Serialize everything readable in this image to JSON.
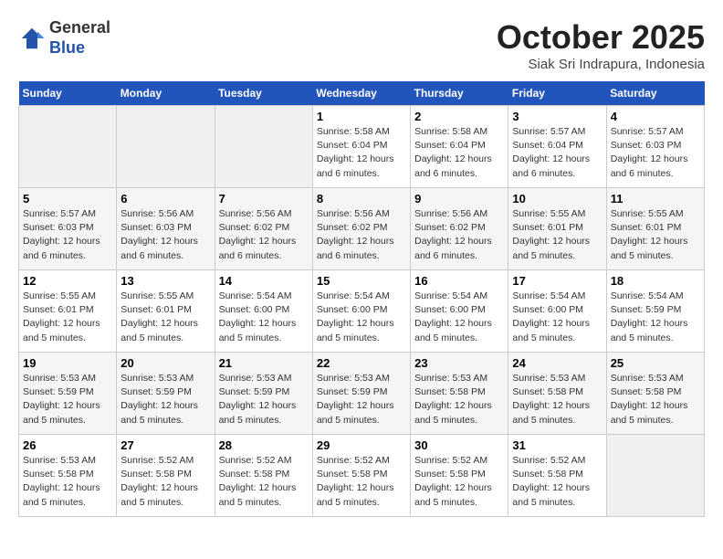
{
  "header": {
    "logo_line1": "General",
    "logo_line2": "Blue",
    "month": "October 2025",
    "location": "Siak Sri Indrapura, Indonesia"
  },
  "weekdays": [
    "Sunday",
    "Monday",
    "Tuesday",
    "Wednesday",
    "Thursday",
    "Friday",
    "Saturday"
  ],
  "weeks": [
    [
      {
        "day": "",
        "info": ""
      },
      {
        "day": "",
        "info": ""
      },
      {
        "day": "",
        "info": ""
      },
      {
        "day": "1",
        "info": "Sunrise: 5:58 AM\nSunset: 6:04 PM\nDaylight: 12 hours\nand 6 minutes."
      },
      {
        "day": "2",
        "info": "Sunrise: 5:58 AM\nSunset: 6:04 PM\nDaylight: 12 hours\nand 6 minutes."
      },
      {
        "day": "3",
        "info": "Sunrise: 5:57 AM\nSunset: 6:04 PM\nDaylight: 12 hours\nand 6 minutes."
      },
      {
        "day": "4",
        "info": "Sunrise: 5:57 AM\nSunset: 6:03 PM\nDaylight: 12 hours\nand 6 minutes."
      }
    ],
    [
      {
        "day": "5",
        "info": "Sunrise: 5:57 AM\nSunset: 6:03 PM\nDaylight: 12 hours\nand 6 minutes."
      },
      {
        "day": "6",
        "info": "Sunrise: 5:56 AM\nSunset: 6:03 PM\nDaylight: 12 hours\nand 6 minutes."
      },
      {
        "day": "7",
        "info": "Sunrise: 5:56 AM\nSunset: 6:02 PM\nDaylight: 12 hours\nand 6 minutes."
      },
      {
        "day": "8",
        "info": "Sunrise: 5:56 AM\nSunset: 6:02 PM\nDaylight: 12 hours\nand 6 minutes."
      },
      {
        "day": "9",
        "info": "Sunrise: 5:56 AM\nSunset: 6:02 PM\nDaylight: 12 hours\nand 6 minutes."
      },
      {
        "day": "10",
        "info": "Sunrise: 5:55 AM\nSunset: 6:01 PM\nDaylight: 12 hours\nand 5 minutes."
      },
      {
        "day": "11",
        "info": "Sunrise: 5:55 AM\nSunset: 6:01 PM\nDaylight: 12 hours\nand 5 minutes."
      }
    ],
    [
      {
        "day": "12",
        "info": "Sunrise: 5:55 AM\nSunset: 6:01 PM\nDaylight: 12 hours\nand 5 minutes."
      },
      {
        "day": "13",
        "info": "Sunrise: 5:55 AM\nSunset: 6:01 PM\nDaylight: 12 hours\nand 5 minutes."
      },
      {
        "day": "14",
        "info": "Sunrise: 5:54 AM\nSunset: 6:00 PM\nDaylight: 12 hours\nand 5 minutes."
      },
      {
        "day": "15",
        "info": "Sunrise: 5:54 AM\nSunset: 6:00 PM\nDaylight: 12 hours\nand 5 minutes."
      },
      {
        "day": "16",
        "info": "Sunrise: 5:54 AM\nSunset: 6:00 PM\nDaylight: 12 hours\nand 5 minutes."
      },
      {
        "day": "17",
        "info": "Sunrise: 5:54 AM\nSunset: 6:00 PM\nDaylight: 12 hours\nand 5 minutes."
      },
      {
        "day": "18",
        "info": "Sunrise: 5:54 AM\nSunset: 5:59 PM\nDaylight: 12 hours\nand 5 minutes."
      }
    ],
    [
      {
        "day": "19",
        "info": "Sunrise: 5:53 AM\nSunset: 5:59 PM\nDaylight: 12 hours\nand 5 minutes."
      },
      {
        "day": "20",
        "info": "Sunrise: 5:53 AM\nSunset: 5:59 PM\nDaylight: 12 hours\nand 5 minutes."
      },
      {
        "day": "21",
        "info": "Sunrise: 5:53 AM\nSunset: 5:59 PM\nDaylight: 12 hours\nand 5 minutes."
      },
      {
        "day": "22",
        "info": "Sunrise: 5:53 AM\nSunset: 5:59 PM\nDaylight: 12 hours\nand 5 minutes."
      },
      {
        "day": "23",
        "info": "Sunrise: 5:53 AM\nSunset: 5:58 PM\nDaylight: 12 hours\nand 5 minutes."
      },
      {
        "day": "24",
        "info": "Sunrise: 5:53 AM\nSunset: 5:58 PM\nDaylight: 12 hours\nand 5 minutes."
      },
      {
        "day": "25",
        "info": "Sunrise: 5:53 AM\nSunset: 5:58 PM\nDaylight: 12 hours\nand 5 minutes."
      }
    ],
    [
      {
        "day": "26",
        "info": "Sunrise: 5:53 AM\nSunset: 5:58 PM\nDaylight: 12 hours\nand 5 minutes."
      },
      {
        "day": "27",
        "info": "Sunrise: 5:52 AM\nSunset: 5:58 PM\nDaylight: 12 hours\nand 5 minutes."
      },
      {
        "day": "28",
        "info": "Sunrise: 5:52 AM\nSunset: 5:58 PM\nDaylight: 12 hours\nand 5 minutes."
      },
      {
        "day": "29",
        "info": "Sunrise: 5:52 AM\nSunset: 5:58 PM\nDaylight: 12 hours\nand 5 minutes."
      },
      {
        "day": "30",
        "info": "Sunrise: 5:52 AM\nSunset: 5:58 PM\nDaylight: 12 hours\nand 5 minutes."
      },
      {
        "day": "31",
        "info": "Sunrise: 5:52 AM\nSunset: 5:58 PM\nDaylight: 12 hours\nand 5 minutes."
      },
      {
        "day": "",
        "info": ""
      }
    ]
  ]
}
